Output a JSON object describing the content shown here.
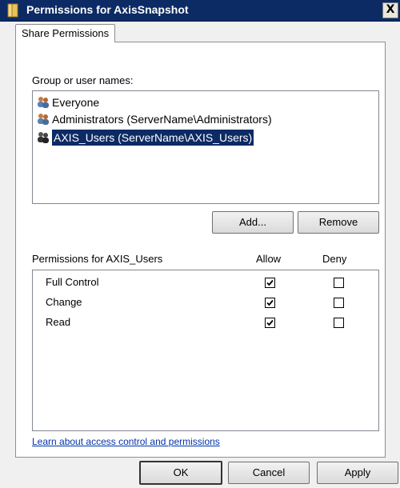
{
  "window": {
    "title": "Permissions for AxisSnapshot",
    "close_glyph": "X"
  },
  "tabs": [
    {
      "label": "Share Permissions",
      "selected": true
    }
  ],
  "group_section": {
    "label": "Group or user names:",
    "users": [
      {
        "name": "Everyone",
        "icon": "users-icon",
        "selected": false
      },
      {
        "name": "Administrators (ServerName\\Administrators)",
        "icon": "users-icon",
        "selected": false
      },
      {
        "name": "AXIS_Users (ServerName\\AXIS_Users)",
        "icon": "users-icon",
        "selected": true
      }
    ],
    "add_label": "Add...",
    "remove_label": "Remove"
  },
  "permissions": {
    "header": "Permissions for AXIS_Users",
    "allow_header": "Allow",
    "deny_header": "Deny",
    "rows": [
      {
        "name": "Full Control",
        "allow": true,
        "deny": false
      },
      {
        "name": "Change",
        "allow": true,
        "deny": false
      },
      {
        "name": "Read",
        "allow": true,
        "deny": false
      }
    ]
  },
  "help_link": "Learn about access control and permissions",
  "buttons": {
    "ok": "OK",
    "cancel": "Cancel",
    "apply": "Apply"
  },
  "colors": {
    "titlebar": "#0c2a64",
    "selection": "#0c2a64",
    "link": "#0033aa"
  }
}
